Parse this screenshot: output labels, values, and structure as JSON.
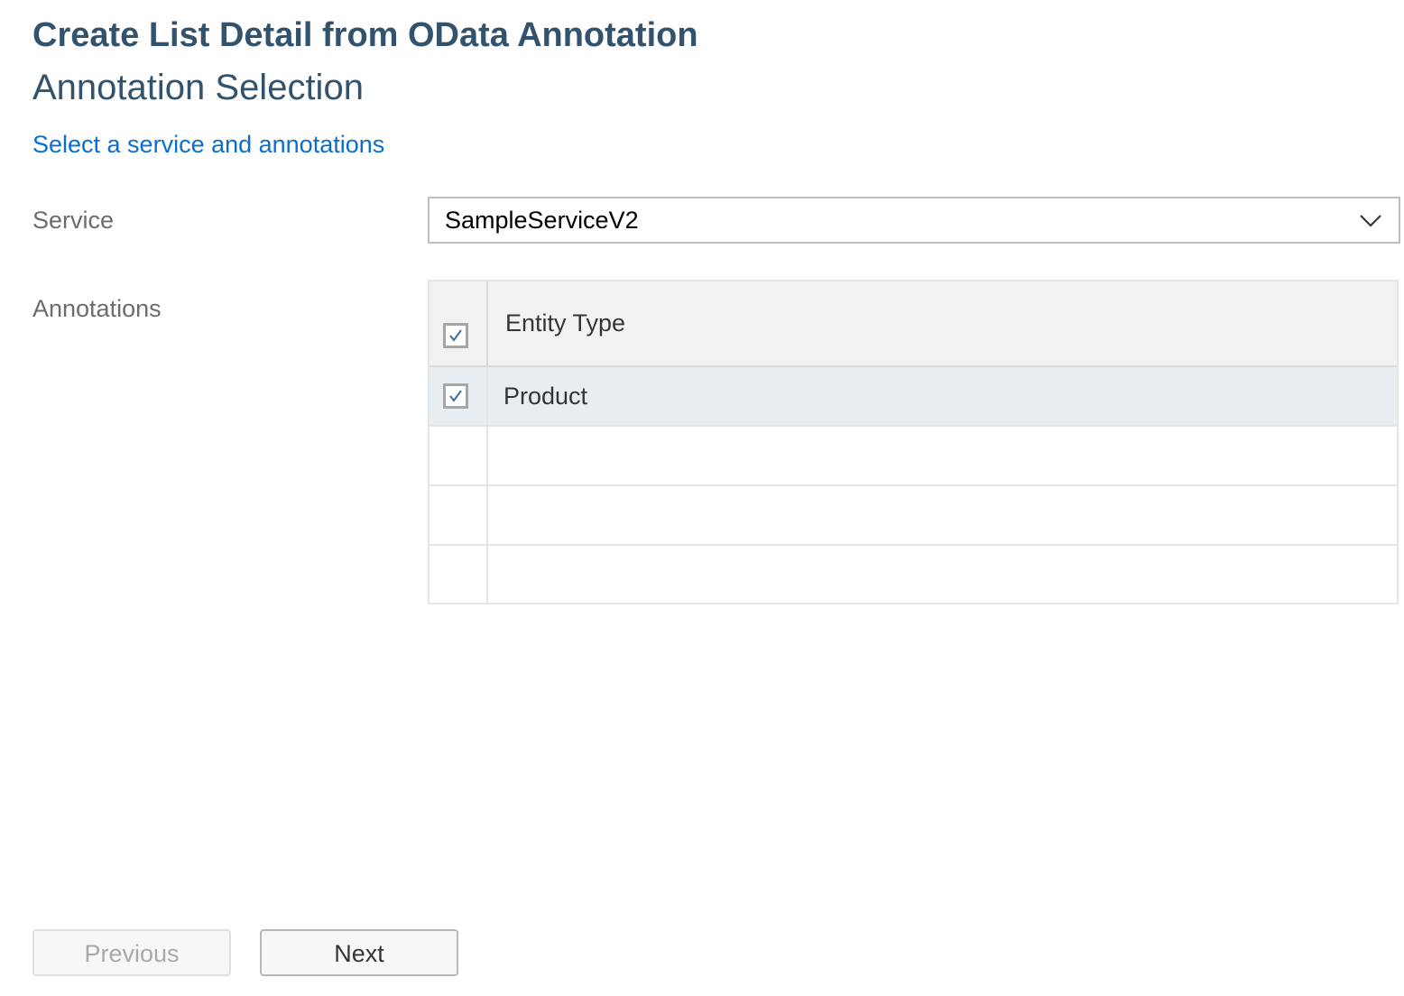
{
  "header": {
    "title": "Create List Detail from OData Annotation",
    "subtitle": "Annotation Selection",
    "instruction": "Select a service and annotations"
  },
  "form": {
    "service_label": "Service",
    "service_value": "SampleServiceV2",
    "annotations_label": "Annotations"
  },
  "annotations_table": {
    "header": {
      "column": "Entity Type",
      "select_all_checked": true
    },
    "rows": [
      {
        "entity_type": "Product",
        "checked": true
      }
    ]
  },
  "footer": {
    "previous_label": "Previous",
    "next_label": "Next",
    "previous_enabled": false
  },
  "colors": {
    "title": "#32536e",
    "link": "#0a6ed1",
    "selected_row": "#e8edf2",
    "header_row": "#f2f2f2"
  }
}
